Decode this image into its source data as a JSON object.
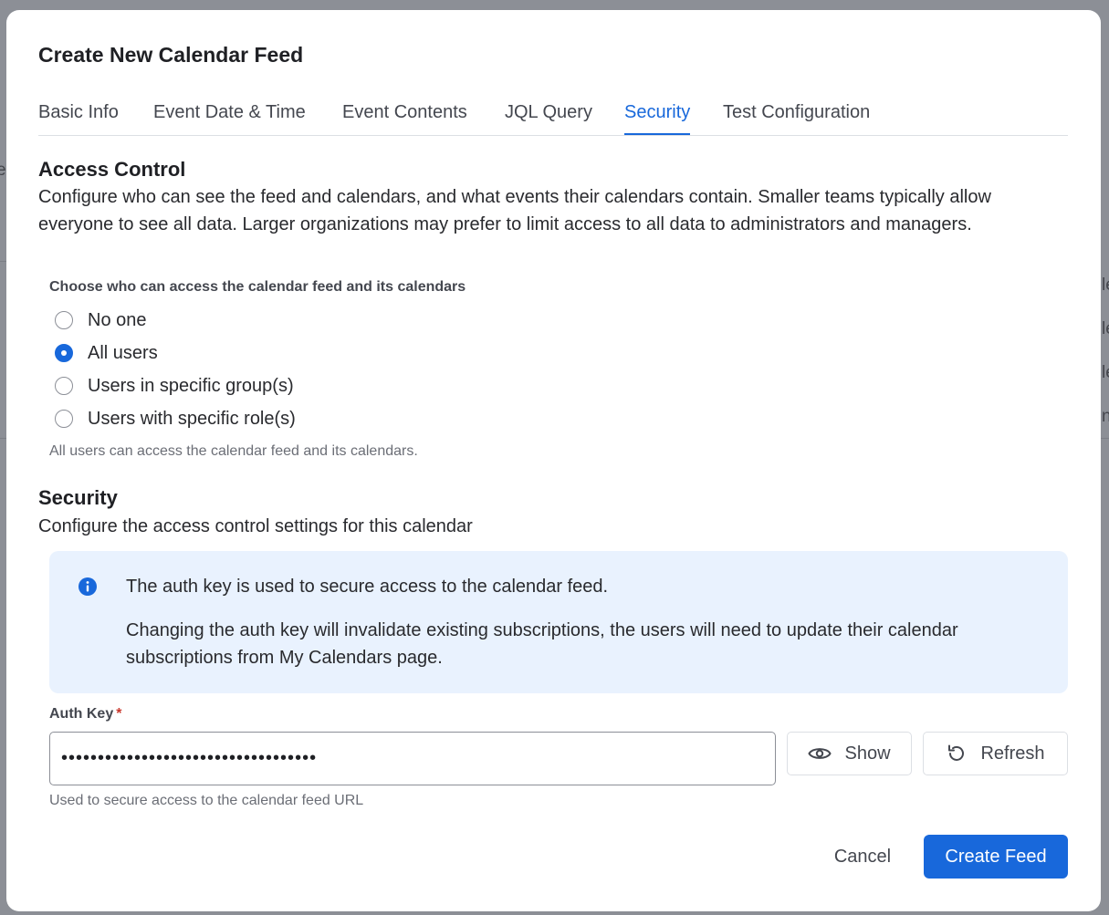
{
  "dialog": {
    "title": "Create New Calendar Feed",
    "tabs": [
      {
        "label": "Basic Info"
      },
      {
        "label": "Event Date & Time"
      },
      {
        "label": "Event Contents"
      },
      {
        "label": "JQL Query"
      },
      {
        "label": "Security",
        "active": true
      },
      {
        "label": "Test Configuration"
      }
    ]
  },
  "access_control": {
    "heading": "Access Control",
    "description": "Configure who can see the feed and calendars, and what events their calendars contain. Smaller teams typically allow everyone to see all data. Larger organizations may prefer to limit access to all data to administrators and managers.",
    "question": "Choose who can access the calendar feed and its calendars",
    "options": [
      {
        "label": "No one",
        "selected": false
      },
      {
        "label": "All users",
        "selected": true
      },
      {
        "label": "Users in specific group(s)",
        "selected": false
      },
      {
        "label": "Users with specific role(s)",
        "selected": false
      }
    ],
    "help": "All users can access the calendar feed and its calendars."
  },
  "security": {
    "heading": "Security",
    "description": "Configure the access control settings for this calendar",
    "info_line1": "The auth key is used to secure access to the calendar feed.",
    "info_line2": "Changing the auth key will invalidate existing subscriptions, the users will need to update their calendar subscriptions from My Calendars page.",
    "auth_key_label": "Auth Key",
    "required_marker": "*",
    "auth_key_value": "•••••••••••••••••••••••••••••••••••",
    "show_label": "Show",
    "refresh_label": "Refresh",
    "auth_key_help": "Used to secure access to the calendar feed URL"
  },
  "footer": {
    "cancel_label": "Cancel",
    "create_label": "Create Feed"
  },
  "colors": {
    "accent": "#1868db",
    "info_background": "#e9f2fe",
    "required": "#c9372c",
    "overlay": "#8c8f96"
  }
}
